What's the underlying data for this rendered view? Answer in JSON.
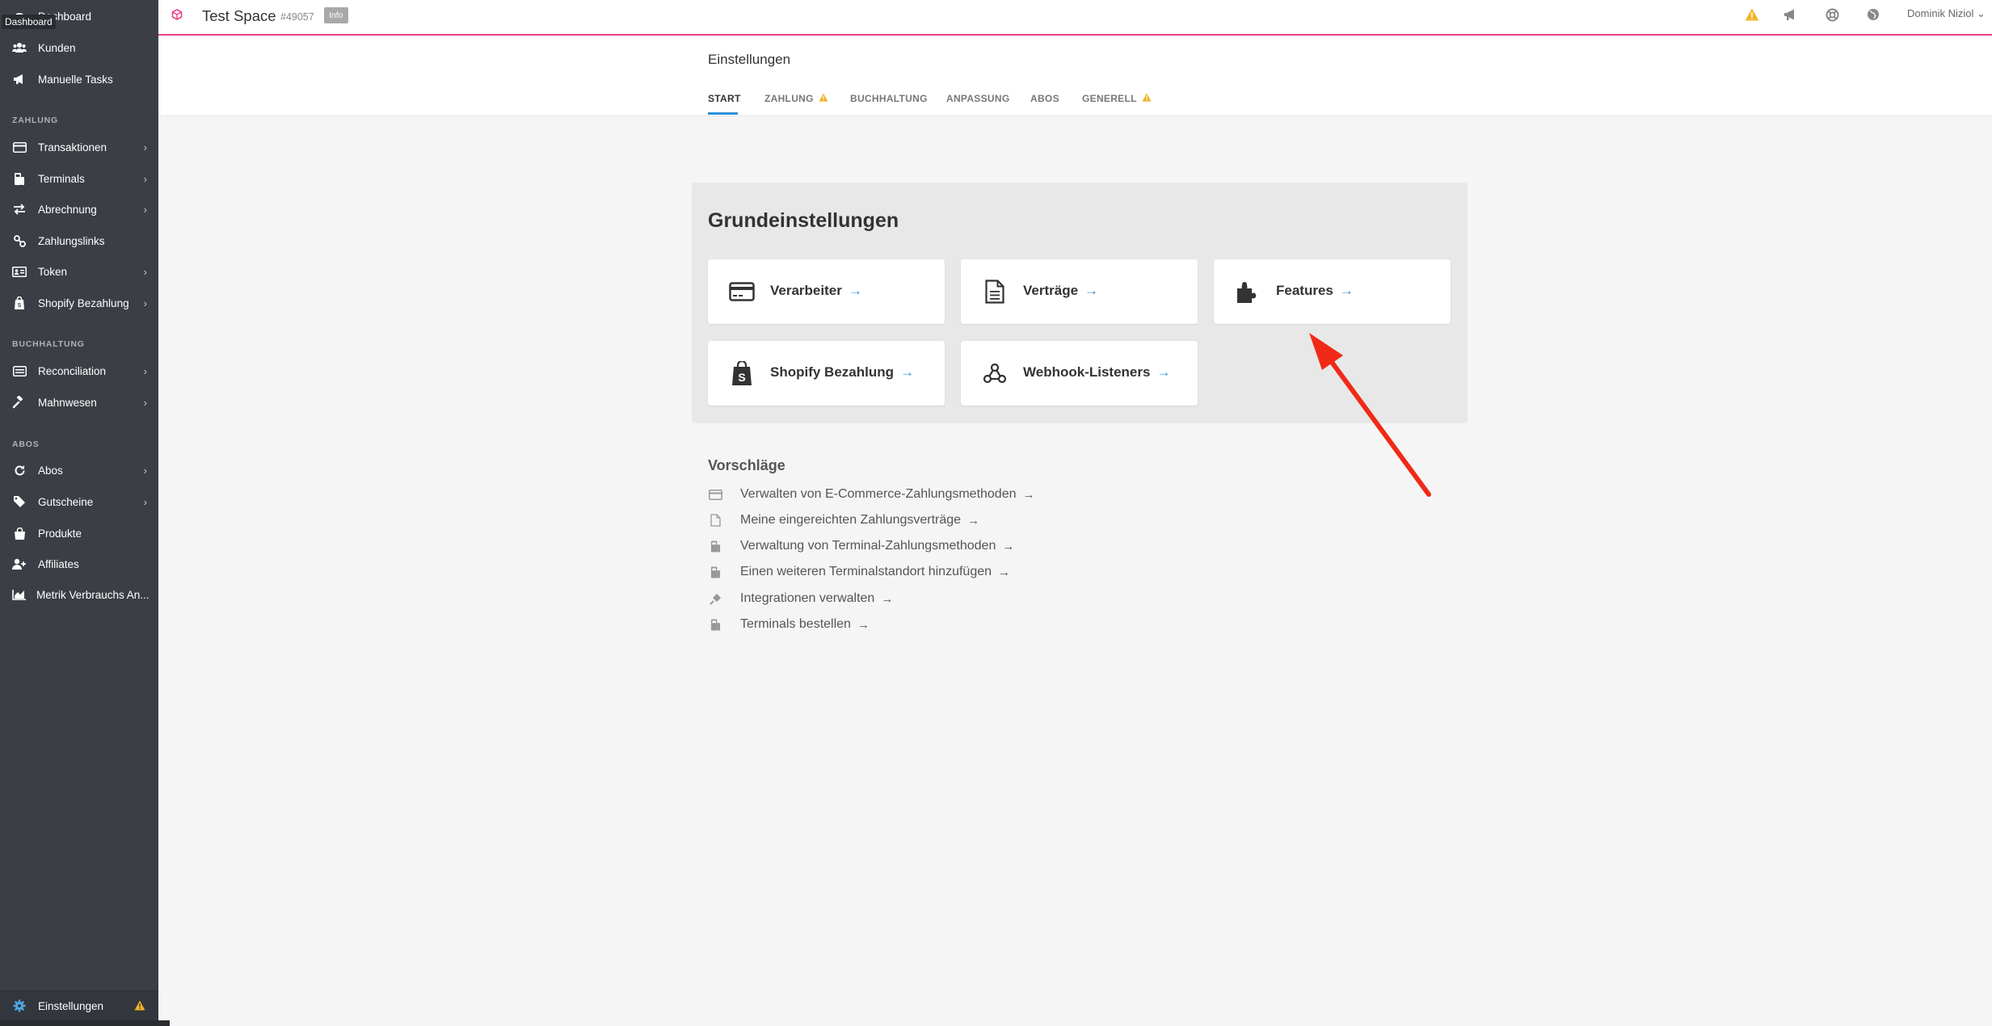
{
  "tooltip": "Dashboard",
  "sidebar": {
    "items_top": [
      {
        "label": "Dashboard",
        "icon": "dashboard-icon"
      },
      {
        "label": "Kunden",
        "icon": "users-icon"
      },
      {
        "label": "Manuelle Tasks",
        "icon": "megaphone-icon"
      }
    ],
    "sections": [
      {
        "title": "ZAHLUNG",
        "items": [
          {
            "label": "Transaktionen",
            "icon": "credit-card-icon",
            "chevron": true
          },
          {
            "label": "Terminals",
            "icon": "terminal-icon",
            "chevron": true
          },
          {
            "label": "Abrechnung",
            "icon": "exchange-icon",
            "chevron": true
          },
          {
            "label": "Zahlungslinks",
            "icon": "link-icon",
            "chevron": false
          },
          {
            "label": "Token",
            "icon": "id-card-icon",
            "chevron": true
          },
          {
            "label": "Shopify Bezahlung",
            "icon": "shopify-icon",
            "chevron": true
          }
        ]
      },
      {
        "title": "BUCHHALTUNG",
        "items": [
          {
            "label": "Reconciliation",
            "icon": "list-card-icon",
            "chevron": true
          },
          {
            "label": "Mahnwesen",
            "icon": "gavel-icon",
            "chevron": true
          }
        ]
      },
      {
        "title": "ABOS",
        "items": [
          {
            "label": "Abos",
            "icon": "refresh-icon",
            "chevron": true
          },
          {
            "label": "Gutscheine",
            "icon": "tag-icon",
            "chevron": true
          },
          {
            "label": "Produkte",
            "icon": "bag-icon",
            "chevron": false
          },
          {
            "label": "Affiliates",
            "icon": "user-plus-icon",
            "chevron": false
          },
          {
            "label": "Metrik Verbrauchs An...",
            "icon": "area-chart-icon",
            "chevron": false
          }
        ]
      }
    ],
    "bottom": {
      "label": "Einstellungen",
      "icon": "gear-icon",
      "warning": true
    }
  },
  "topbar": {
    "space_title": "Test Space",
    "space_id": "#49057",
    "info_badge": "Info",
    "user_name": "Dominik Niziol ⌄",
    "icons": [
      "warning-icon",
      "megaphone-icon",
      "lifebuoy-icon",
      "globe-icon"
    ]
  },
  "settings": {
    "title": "Einstellungen",
    "tabs": [
      {
        "label": "START",
        "active": true,
        "warning": false
      },
      {
        "label": "ZAHLUNG",
        "active": false,
        "warning": true
      },
      {
        "label": "BUCHHALTUNG",
        "active": false,
        "warning": false
      },
      {
        "label": "ANPASSUNG",
        "active": false,
        "warning": false
      },
      {
        "label": "ABOS",
        "active": false,
        "warning": false
      },
      {
        "label": "GENERELL",
        "active": false,
        "warning": true
      }
    ]
  },
  "panel": {
    "title": "Grundeinstellungen",
    "cards": [
      {
        "label": "Verarbeiter",
        "icon": "credit-card-icon"
      },
      {
        "label": "Verträge",
        "icon": "document-icon"
      },
      {
        "label": "Features",
        "icon": "puzzle-icon"
      },
      {
        "label": "Shopify Bezahlung",
        "icon": "shopify-bag-icon"
      },
      {
        "label": "Webhook-Listeners",
        "icon": "webhook-icon"
      }
    ],
    "arrow": "→"
  },
  "suggestions": {
    "title": "Vorschläge",
    "items": [
      {
        "label": "Verwalten von E-Commerce-Zahlungsmethoden",
        "icon": "credit-card-icon"
      },
      {
        "label": "Meine eingereichten Zahlungsverträge",
        "icon": "document-icon"
      },
      {
        "label": "Verwaltung von Terminal-Zahlungsmethoden",
        "icon": "terminal-icon"
      },
      {
        "label": "Einen weiteren Terminalstandort hinzufügen",
        "icon": "terminal-icon"
      },
      {
        "label": "Integrationen verwalten",
        "icon": "plug-icon"
      },
      {
        "label": "Terminals bestellen",
        "icon": "terminal-icon"
      }
    ],
    "arrow": "→"
  },
  "colors": {
    "sidebar_bg": "#3b3e45",
    "accent_blue": "#2c8fd8",
    "accent_pink": "#e9418a",
    "warning": "#f0b429",
    "annotation_red": "#f02a17"
  }
}
